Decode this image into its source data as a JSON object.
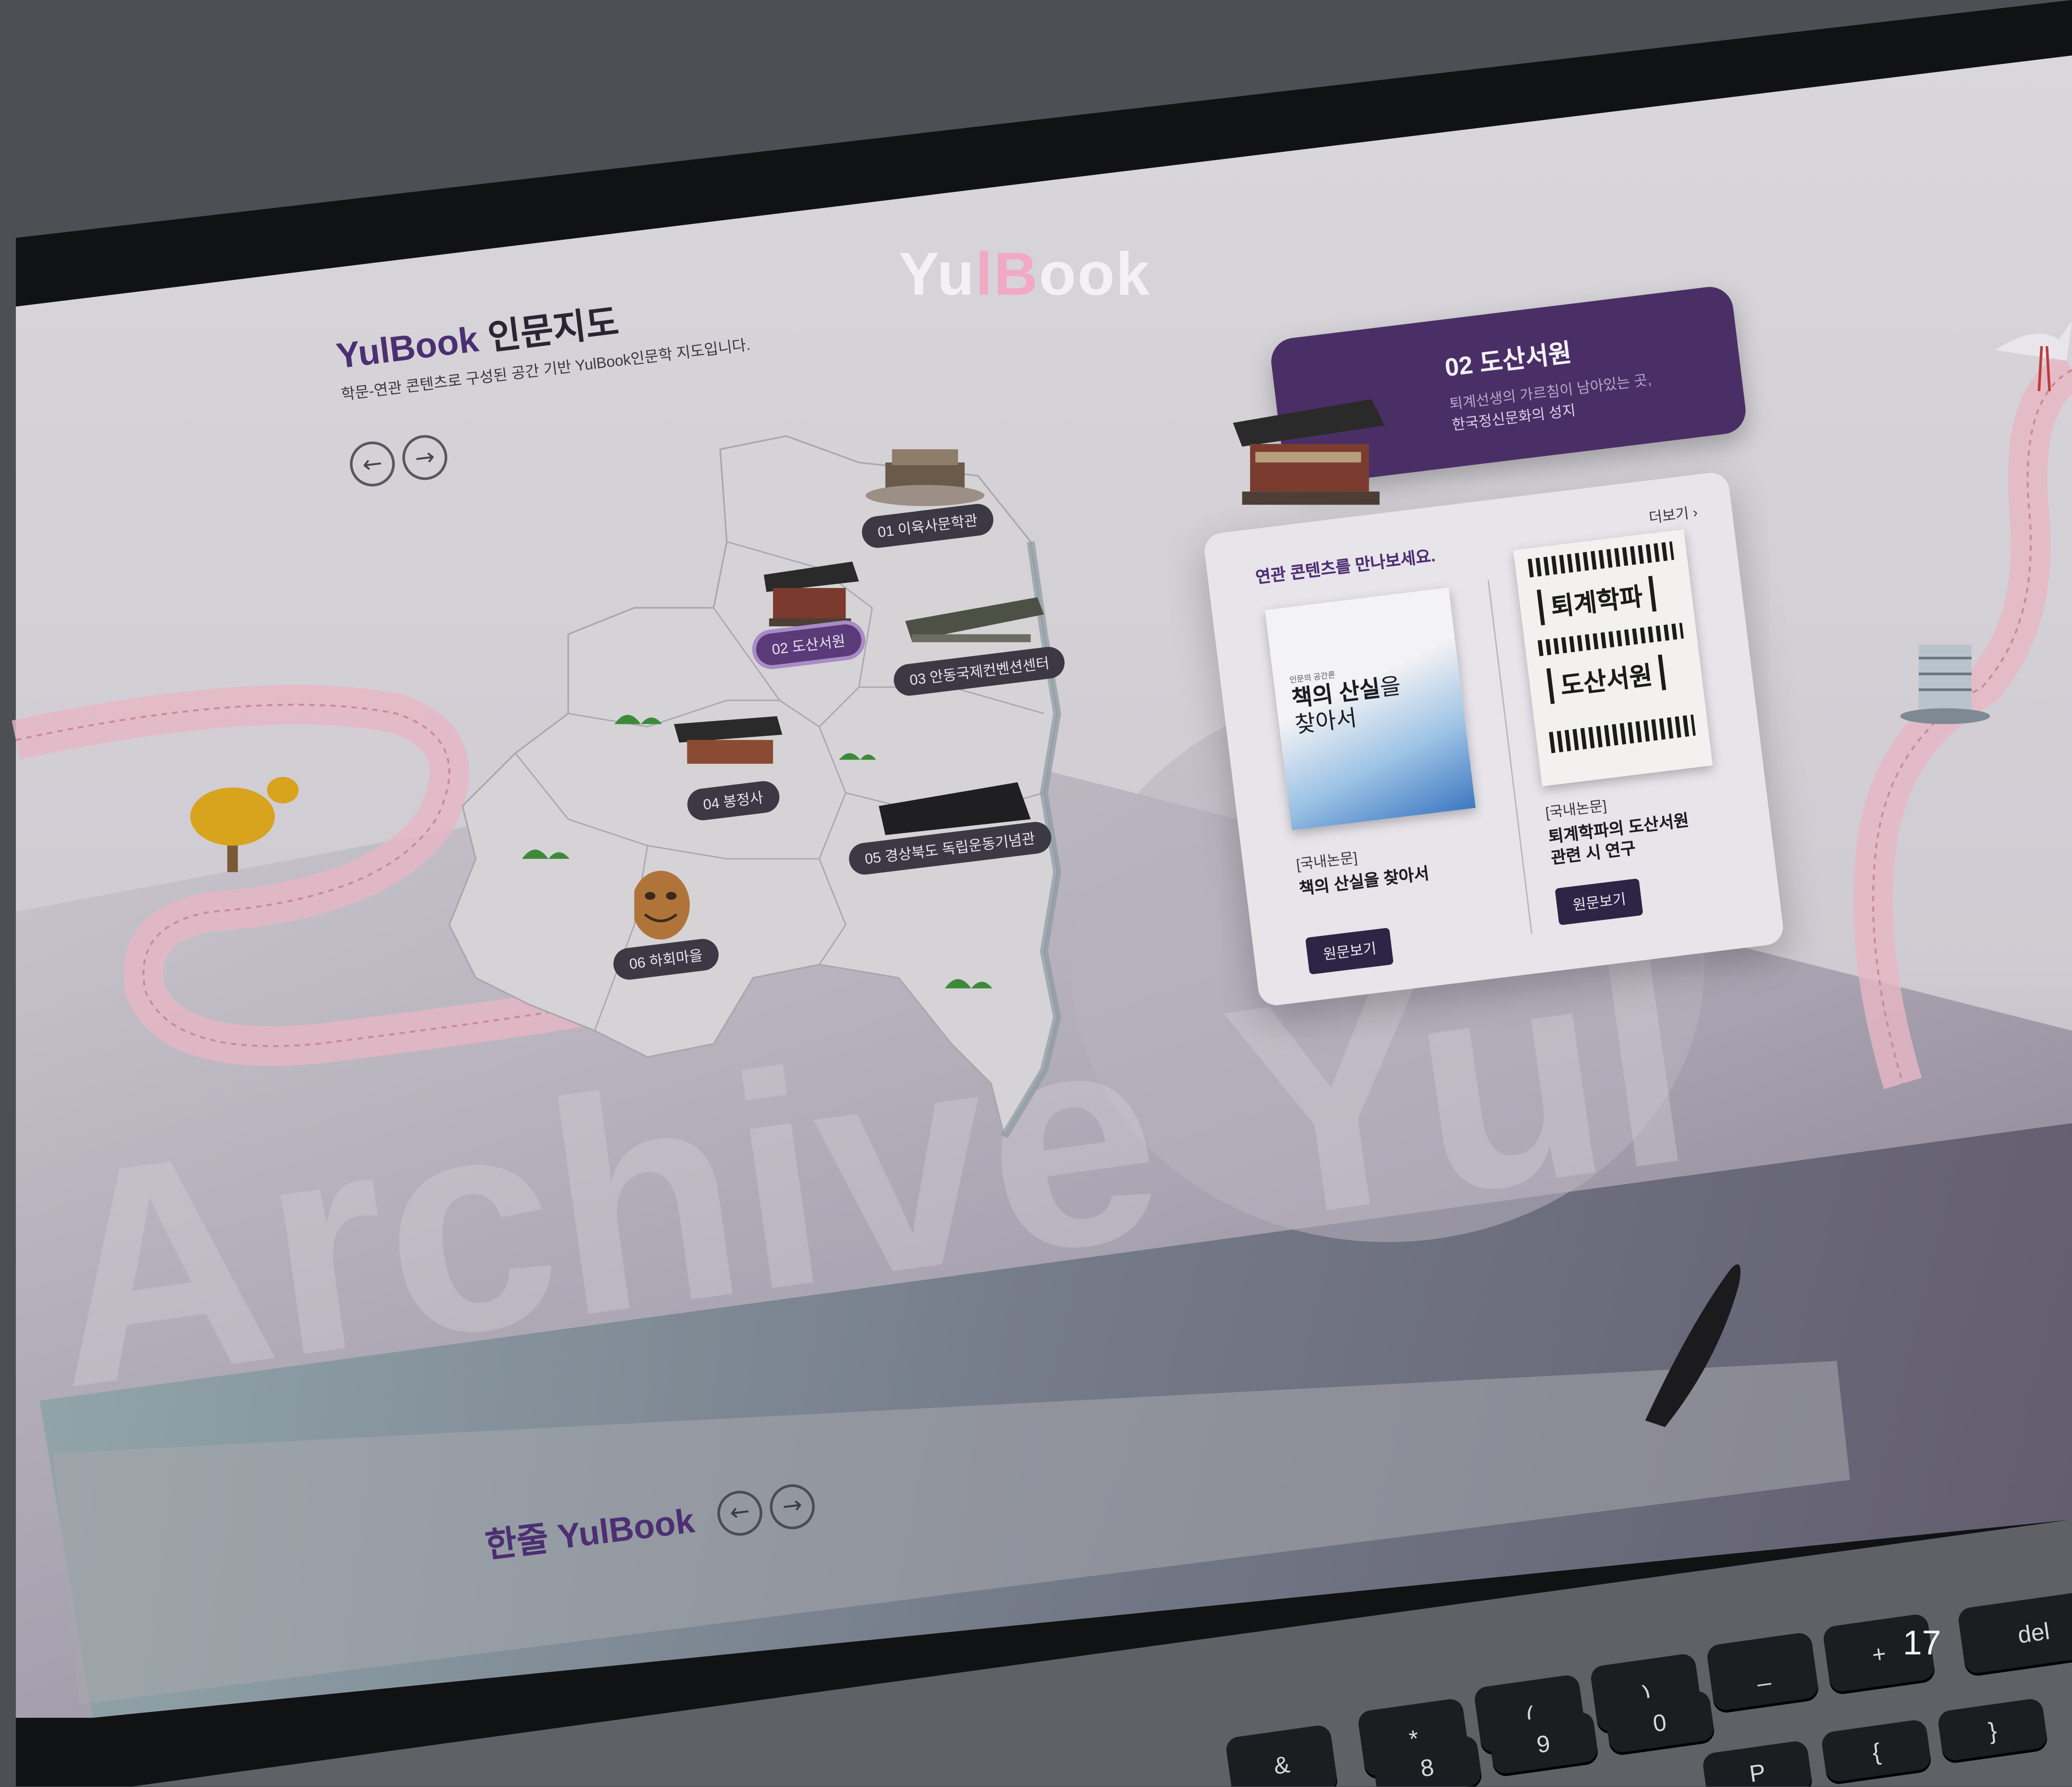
{
  "brand": {
    "logo_prefix": "Yu",
    "logo_accent": "lB",
    "logo_suffix": "ook",
    "accent_color": "#f2a9c3"
  },
  "page_number": "17",
  "map_section": {
    "title_brand": "YulBook",
    "title_text": "인문지도",
    "subtitle": "학문-연관 콘텐츠로 구성된 공간 기반 YulBook인문학 지도입니다.",
    "prev_icon": "arrow-left-icon",
    "next_icon": "arrow-right-icon",
    "locations": [
      {
        "label": "01 이육사문학관"
      },
      {
        "label": "02 도산서원",
        "active": true
      },
      {
        "label": "03 안동국제컨벤션센터"
      },
      {
        "label": "04 봉정사"
      },
      {
        "label": "05 경상북도 독립운동기념관"
      },
      {
        "label": "06 하회마을"
      }
    ]
  },
  "detail_card": {
    "title": "02 도산서원",
    "description_line1": "퇴계선생의 가르침이 남아있는 곳,",
    "description_line2": "한국정신문화의 성지",
    "more_label": "더보기",
    "section_label": "연관 콘텐츠를 만나보세요.",
    "header_color": "#4a2f66",
    "books": [
      {
        "cover_small": "인문의 공간론",
        "cover_title_a": "책의 산실",
        "cover_title_b": "을",
        "cover_title_c": "찾아서",
        "category": "[국내논문]",
        "title": "책의 산실을 찾아서",
        "button": "원문보기"
      },
      {
        "cover_title_a": "퇴계학파",
        "cover_title_b": "도산서원",
        "category": "[국내논문]",
        "title_line1": "퇴계학파의 도산서원",
        "title_line2": "관련 시 연구",
        "button": "원문보기"
      }
    ]
  },
  "background_text": "Archive Yul",
  "bottom_section": {
    "title_prefix": "한줄",
    "title_brand": "YulBook",
    "prev_icon": "arrow-left-icon",
    "next_icon": "arrow-right-icon"
  },
  "keyboard": {
    "keys": [
      "&",
      "*",
      "(",
      ")",
      "_",
      "+",
      "8",
      "9",
      "0",
      "-",
      "=",
      "P",
      "{",
      "}",
      "del"
    ]
  }
}
